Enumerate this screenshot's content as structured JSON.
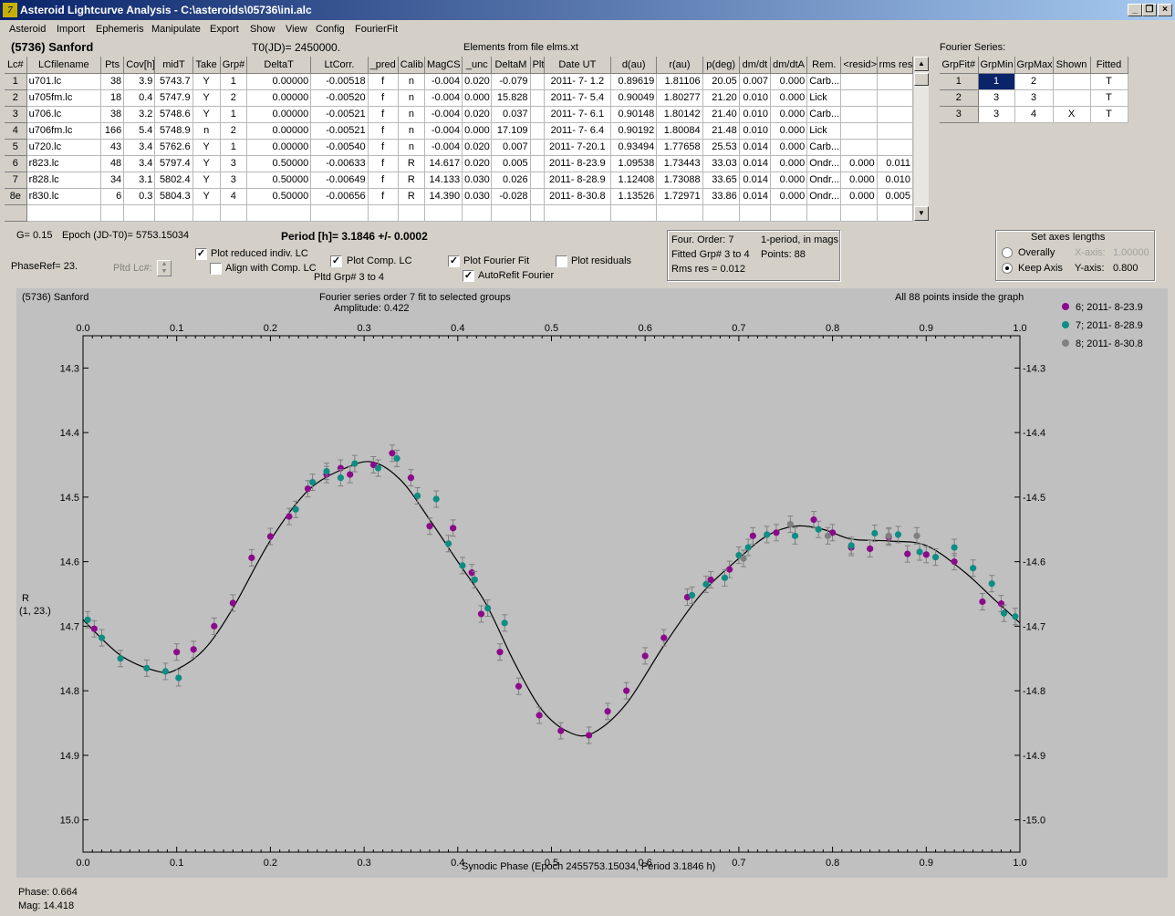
{
  "window": {
    "title": "Asteroid Lightcurve Analysis - C:\\asteroids\\05736\\ini.alc",
    "icon": "app-icon",
    "btn_min": "_",
    "btn_restore": "❐",
    "btn_close": "×"
  },
  "menu": [
    "Asteroid",
    "Import",
    "Ephemeris",
    "Manipulate",
    "Export",
    "Show",
    "View",
    "Config",
    "FourierFit"
  ],
  "header": {
    "asteroid": "(5736) Sanford",
    "t0": "T0(JD)= 2450000.",
    "elements": "Elements from file elms.xt",
    "fourier_label": "Fourier Series:"
  },
  "lc_table": {
    "columns": [
      "Lc#",
      "LCfilename",
      "Pts",
      "Cov[h]",
      "midT",
      "Take",
      "Grp#",
      "DeltaT",
      "LtCorr.",
      "_pred",
      "Calib.",
      "MagCS",
      "_unc",
      "DeltaM",
      "Plt",
      "Date UT",
      "d(au)",
      "r(au)",
      "p(deg)",
      "dm/dt",
      "dm/dtA",
      "Rem.",
      "<resid>",
      "rms res"
    ],
    "rows": [
      [
        "1",
        "u701.lc",
        "38",
        "3.9",
        "5743.7",
        "Y",
        "1",
        "0.00000",
        "-0.00518",
        "f",
        "n",
        "-0.004",
        "0.020",
        "-0.079",
        "",
        "2011- 7- 1.2",
        "0.89619",
        "1.81106",
        "20.05",
        "0.007",
        "0.000",
        "Carb...",
        "",
        ""
      ],
      [
        "2",
        "u705fm.lc",
        "18",
        "0.4",
        "5747.9",
        "Y",
        "2",
        "0.00000",
        "-0.00520",
        "f",
        "n",
        "-0.004",
        "0.000",
        "15.828",
        "",
        "2011- 7- 5.4",
        "0.90049",
        "1.80277",
        "21.20",
        "0.010",
        "0.000",
        "Lick",
        "",
        ""
      ],
      [
        "3",
        "u706.lc",
        "38",
        "3.2",
        "5748.6",
        "Y",
        "1",
        "0.00000",
        "-0.00521",
        "f",
        "n",
        "-0.004",
        "0.020",
        "0.037",
        "",
        "2011- 7- 6.1",
        "0.90148",
        "1.80142",
        "21.40",
        "0.010",
        "0.000",
        "Carb...",
        "",
        ""
      ],
      [
        "4",
        "u706fm.lc",
        "166",
        "5.4",
        "5748.9",
        "n",
        "2",
        "0.00000",
        "-0.00521",
        "f",
        "n",
        "-0.004",
        "0.000",
        "17.109",
        "",
        "2011- 7- 6.4",
        "0.90192",
        "1.80084",
        "21.48",
        "0.010",
        "0.000",
        "Lick",
        "",
        ""
      ],
      [
        "5",
        "u720.lc",
        "43",
        "3.4",
        "5762.6",
        "Y",
        "1",
        "0.00000",
        "-0.00540",
        "f",
        "n",
        "-0.004",
        "0.020",
        "0.007",
        "",
        "2011- 7-20.1",
        "0.93494",
        "1.77658",
        "25.53",
        "0.014",
        "0.000",
        "Carb...",
        "",
        ""
      ],
      [
        "6",
        "r823.lc",
        "48",
        "3.4",
        "5797.4",
        "Y",
        "3",
        "0.50000",
        "-0.00633",
        "f",
        "R",
        "14.617",
        "0.020",
        "0.005",
        "",
        "2011- 8-23.9",
        "1.09538",
        "1.73443",
        "33.03",
        "0.014",
        "0.000",
        "Ondr...",
        "0.000",
        "0.011"
      ],
      [
        "7",
        "r828.lc",
        "34",
        "3.1",
        "5802.4",
        "Y",
        "3",
        "0.50000",
        "-0.00649",
        "f",
        "R",
        "14.133",
        "0.030",
        "0.026",
        "",
        "2011- 8-28.9",
        "1.12408",
        "1.73088",
        "33.65",
        "0.014",
        "0.000",
        "Ondr...",
        "0.000",
        "0.010"
      ],
      [
        "8e",
        "r830.lc",
        "6",
        "0.3",
        "5804.3",
        "Y",
        "4",
        "0.50000",
        "-0.00656",
        "f",
        "R",
        "14.390",
        "0.030",
        "-0.028",
        "",
        "2011- 8-30.8",
        "1.13526",
        "1.72971",
        "33.86",
        "0.014",
        "0.000",
        "Ondr...",
        "0.000",
        "0.005"
      ]
    ]
  },
  "fourier_table": {
    "columns": [
      "GrpFit#",
      "GrpMin",
      "GrpMax",
      "Shown",
      "Fitted"
    ],
    "rows": [
      [
        "1",
        "1",
        "2",
        "",
        "T"
      ],
      [
        "2",
        "3",
        "3",
        "",
        "T"
      ],
      [
        "3",
        "3",
        "4",
        "X",
        "T"
      ]
    ]
  },
  "controls": {
    "g_value": "G= 0.15",
    "epoch": "Epoch (JD-T0)= 5753.15034",
    "period": "Period [h]= 3.1846 +/- 0.0002",
    "phaseref": "PhaseRef= 23.",
    "pltd_lc": "Pltd Lc#:",
    "plot_reduced": "Plot reduced indiv. LC",
    "align_comp": "Align with Comp. LC",
    "plot_comp": "Plot Comp. LC",
    "pltd_grp": "Pltd Grp#  3   to   4",
    "plot_fourier": "Plot Fourier Fit",
    "autorefit": "AutoRefit Fourier",
    "plot_residuals": "Plot residuals",
    "check": "✓"
  },
  "fourier_info": {
    "order": "Four. Order:  7",
    "mode": "1-period, in mags",
    "fitted": "Fitted Grp# 3 to 4",
    "points": "Points: 88",
    "rms": "Rms res     = 0.012"
  },
  "axes_box": {
    "title": "Set axes lengths",
    "overall": "Overally",
    "keep": "Keep Axis",
    "xaxis_label": "X-axis:",
    "xaxis_value": "1.00000",
    "yaxis_label": "Y-axis:",
    "yaxis_value": "0.800"
  },
  "plot": {
    "name": "(5736) Sanford",
    "fit_title": "Fourier series order 7 fit to selected groups",
    "amplitude": "Amplitude: 0.422",
    "inside": "All 88 points inside the graph",
    "ylabel1": "R",
    "ylabel2": "(1, 23.)",
    "xlabel": "Synodic Phase (Epoch 2455753.15034, Period 3.1846 h)"
  },
  "status": {
    "phase": "Phase:  0.664",
    "mag": "Mag:   14.418"
  },
  "chart_data": {
    "type": "scatter",
    "xlim": [
      0,
      1
    ],
    "ylim": [
      15.05,
      14.25
    ],
    "x_ticks": [
      "0.0",
      "0.1",
      "0.2",
      "0.3",
      "0.4",
      "0.5",
      "0.6",
      "0.7",
      "0.8",
      "0.9",
      "1.0"
    ],
    "y_ticks": [
      "14.3",
      "14.4",
      "14.5",
      "14.6",
      "14.7",
      "14.8",
      "14.9",
      "15.0"
    ],
    "legend_position": "top-right",
    "grid": false,
    "series": [
      {
        "name": "6; 2011- 8-23.9",
        "color": "#8b0a8b",
        "points": [
          [
            0.012,
            14.704
          ],
          [
            0.1,
            14.74
          ],
          [
            0.118,
            14.736
          ],
          [
            0.14,
            14.7
          ],
          [
            0.16,
            14.664
          ],
          [
            0.18,
            14.594
          ],
          [
            0.2,
            14.561
          ],
          [
            0.22,
            14.53
          ],
          [
            0.24,
            14.487
          ],
          [
            0.26,
            14.465
          ],
          [
            0.275,
            14.455
          ],
          [
            0.285,
            14.465
          ],
          [
            0.31,
            14.45
          ],
          [
            0.33,
            14.432
          ],
          [
            0.35,
            14.47
          ],
          [
            0.37,
            14.545
          ],
          [
            0.395,
            14.548
          ],
          [
            0.415,
            14.617
          ],
          [
            0.425,
            14.681
          ],
          [
            0.445,
            14.74
          ],
          [
            0.465,
            14.793
          ],
          [
            0.487,
            14.838
          ],
          [
            0.51,
            14.862
          ],
          [
            0.54,
            14.869
          ],
          [
            0.56,
            14.832
          ],
          [
            0.58,
            14.8
          ],
          [
            0.6,
            14.746
          ],
          [
            0.62,
            14.718
          ],
          [
            0.645,
            14.655
          ],
          [
            0.67,
            14.628
          ],
          [
            0.69,
            14.612
          ],
          [
            0.715,
            14.56
          ],
          [
            0.74,
            14.555
          ],
          [
            0.78,
            14.535
          ],
          [
            0.8,
            14.555
          ],
          [
            0.82,
            14.578
          ],
          [
            0.84,
            14.58
          ],
          [
            0.86,
            14.562
          ],
          [
            0.88,
            14.588
          ],
          [
            0.9,
            14.589
          ],
          [
            0.93,
            14.6
          ],
          [
            0.96,
            14.662
          ],
          [
            0.98,
            14.665
          ]
        ]
      },
      {
        "name": "7; 2011- 8-28.9",
        "color": "#0f8c84",
        "points": [
          [
            0.005,
            14.69
          ],
          [
            0.02,
            14.718
          ],
          [
            0.04,
            14.75
          ],
          [
            0.068,
            14.765
          ],
          [
            0.088,
            14.77
          ],
          [
            0.102,
            14.78
          ],
          [
            0.227,
            14.519
          ],
          [
            0.245,
            14.477
          ],
          [
            0.26,
            14.46
          ],
          [
            0.275,
            14.47
          ],
          [
            0.29,
            14.448
          ],
          [
            0.315,
            14.455
          ],
          [
            0.335,
            14.44
          ],
          [
            0.357,
            14.498
          ],
          [
            0.377,
            14.503
          ],
          [
            0.39,
            14.572
          ],
          [
            0.405,
            14.606
          ],
          [
            0.418,
            14.628
          ],
          [
            0.432,
            14.672
          ],
          [
            0.45,
            14.695
          ],
          [
            0.65,
            14.652
          ],
          [
            0.665,
            14.635
          ],
          [
            0.685,
            14.625
          ],
          [
            0.7,
            14.59
          ],
          [
            0.71,
            14.578
          ],
          [
            0.73,
            14.558
          ],
          [
            0.76,
            14.56
          ],
          [
            0.785,
            14.55
          ],
          [
            0.82,
            14.575
          ],
          [
            0.845,
            14.556
          ],
          [
            0.87,
            14.558
          ],
          [
            0.893,
            14.585
          ],
          [
            0.91,
            14.593
          ],
          [
            0.93,
            14.578
          ],
          [
            0.95,
            14.61
          ],
          [
            0.97,
            14.634
          ],
          [
            0.983,
            14.68
          ],
          [
            0.995,
            14.685
          ]
        ]
      },
      {
        "name": "8; 2011- 8-30.8",
        "color": "#808080",
        "points": [
          [
            0.705,
            14.595
          ],
          [
            0.755,
            14.542
          ],
          [
            0.795,
            14.56
          ],
          [
            0.86,
            14.56
          ],
          [
            0.89,
            14.56
          ]
        ]
      }
    ],
    "fit_curve": [
      [
        0,
        14.69
      ],
      [
        0.04,
        14.745
      ],
      [
        0.08,
        14.77
      ],
      [
        0.1,
        14.767
      ],
      [
        0.13,
        14.735
      ],
      [
        0.16,
        14.672
      ],
      [
        0.2,
        14.567
      ],
      [
        0.24,
        14.49
      ],
      [
        0.28,
        14.455
      ],
      [
        0.31,
        14.446
      ],
      [
        0.34,
        14.475
      ],
      [
        0.37,
        14.535
      ],
      [
        0.4,
        14.6
      ],
      [
        0.43,
        14.665
      ],
      [
        0.46,
        14.755
      ],
      [
        0.49,
        14.83
      ],
      [
        0.52,
        14.865
      ],
      [
        0.545,
        14.865
      ],
      [
        0.58,
        14.82
      ],
      [
        0.62,
        14.73
      ],
      [
        0.66,
        14.65
      ],
      [
        0.7,
        14.595
      ],
      [
        0.73,
        14.56
      ],
      [
        0.76,
        14.545
      ],
      [
        0.79,
        14.55
      ],
      [
        0.82,
        14.565
      ],
      [
        0.86,
        14.568
      ],
      [
        0.9,
        14.575
      ],
      [
        0.94,
        14.615
      ],
      [
        0.97,
        14.655
      ],
      [
        1,
        14.695
      ]
    ]
  }
}
